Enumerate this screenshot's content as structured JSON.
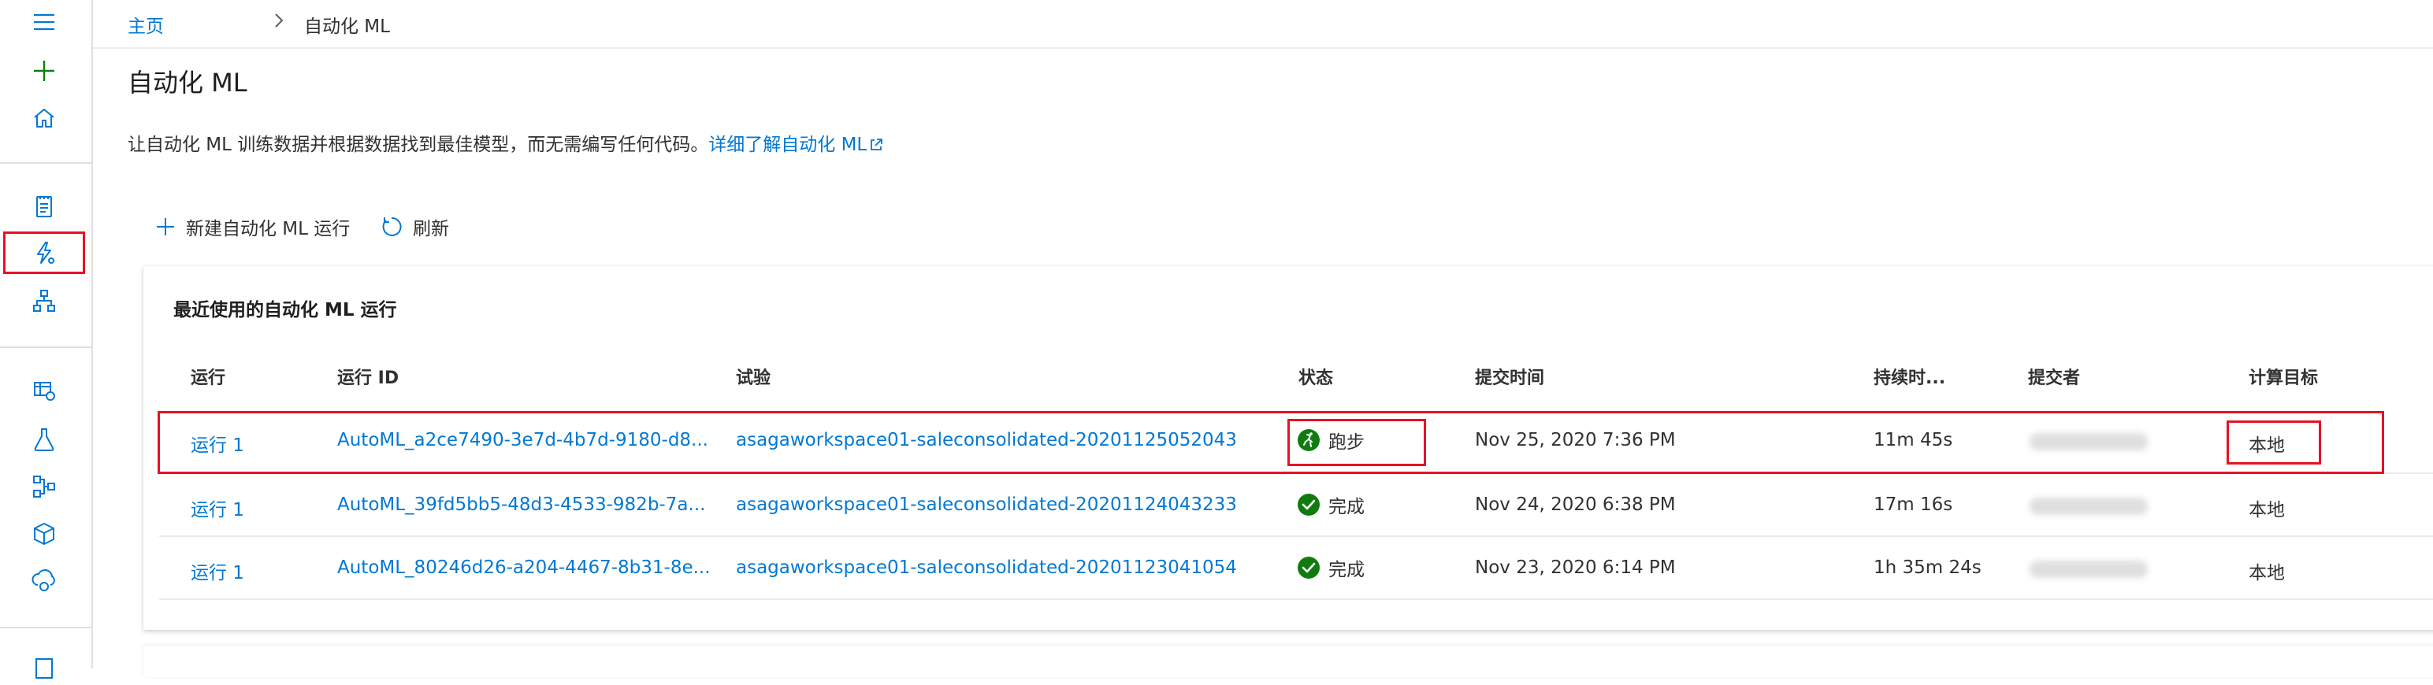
{
  "sidebar": {
    "icons": [
      "menu-icon",
      "plus-icon",
      "home-icon",
      "notebook-icon",
      "automl-icon",
      "designer-icon",
      "datasets-icon",
      "experiments-icon",
      "pipelines-icon",
      "models-icon",
      "endpoints-icon"
    ]
  },
  "breadcrumb": {
    "home": "主页",
    "current": "自动化 ML"
  },
  "page": {
    "title": "自动化 ML",
    "description": "让自动化 ML 训练数据并根据数据找到最佳模型，而无需编写任何代码。",
    "learn_more": "详细了解自动化 ML"
  },
  "toolbar": {
    "new_run": "新建自动化 ML 运行",
    "refresh": "刷新"
  },
  "recent": {
    "title": "最近使用的自动化 ML 运行",
    "columns": [
      "运行",
      "运行 ID",
      "试验",
      "状态",
      "提交时间",
      "持续时...",
      "提交者",
      "计算目标"
    ],
    "rows": [
      {
        "run": "运行 1",
        "run_id": "AutoML_a2ce7490-3e7d-4b7d-9180-d8...",
        "experiment": "asagaworkspace01-saleconsolidated-20201125052043",
        "status": "跑步",
        "status_type": "running",
        "submitted": "Nov 25, 2020 7:36 PM",
        "duration": "11m 45s",
        "compute": "本地"
      },
      {
        "run": "运行 1",
        "run_id": "AutoML_39fd5bb5-48d3-4533-982b-7a...",
        "experiment": "asagaworkspace01-saleconsolidated-20201124043233",
        "status": "完成",
        "status_type": "completed",
        "submitted": "Nov 24, 2020 6:38 PM",
        "duration": "17m 16s",
        "compute": "本地"
      },
      {
        "run": "运行 1",
        "run_id": "AutoML_80246d26-a204-4467-8b31-8e...",
        "experiment": "asagaworkspace01-saleconsolidated-20201123041054",
        "status": "完成",
        "status_type": "completed",
        "submitted": "Nov 23, 2020 6:14 PM",
        "duration": "1h 35m 24s",
        "compute": "本地"
      }
    ]
  },
  "colors": {
    "accent": "#0078d4",
    "success": "#107c10",
    "highlight": "#e81123"
  }
}
